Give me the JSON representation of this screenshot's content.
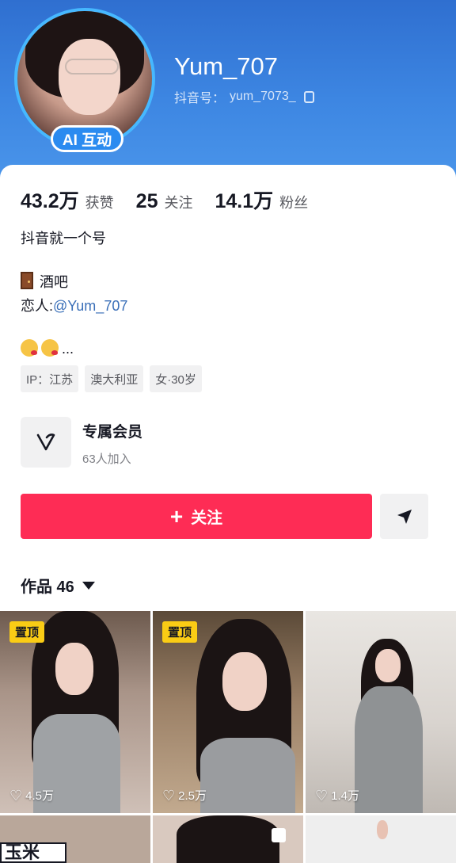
{
  "profile": {
    "username": "Yum_707",
    "douyin_id_label": "抖音号：",
    "douyin_id": "yum_7073_",
    "ai_badge": "AI 互动"
  },
  "stats": [
    {
      "value": "43.2万",
      "label": "获赞"
    },
    {
      "value": "25",
      "label": "关注"
    },
    {
      "value": "14.1万",
      "label": "粉丝"
    }
  ],
  "bio": {
    "line1": "抖音就一个号",
    "line2": "酒吧",
    "line3_prefix": "恋人:",
    "line3_mention": "@Yum_707",
    "line4_suffix": "..."
  },
  "tags": [
    "IP：江苏",
    "澳大利亚",
    "女·30岁"
  ],
  "membership": {
    "title": "专属会员",
    "subtitle": "63人加入"
  },
  "actions": {
    "follow_label": "关注"
  },
  "works": {
    "label": "作品 46"
  },
  "videos": [
    {
      "pinned": "置顶",
      "likes": "4.5万"
    },
    {
      "pinned": "置顶",
      "likes": "2.5万"
    },
    {
      "pinned": "",
      "likes": "1.4万"
    }
  ],
  "bottom_partial_text": "玉米",
  "colors": {
    "header_blue": "#3d86e2",
    "follow_red": "#fe2c55",
    "pin_yellow": "#facc15",
    "mention_blue": "#3a6fb8"
  }
}
